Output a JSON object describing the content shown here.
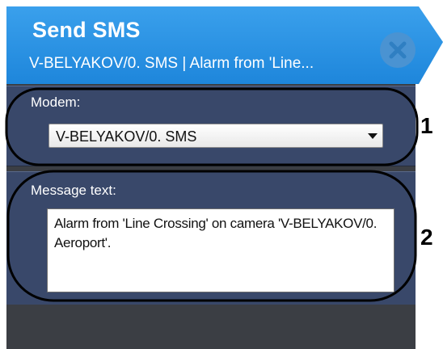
{
  "dialog": {
    "title": "Send SMS",
    "subtitle": "V-BELYAKOV/0. SMS | Alarm from 'Line...",
    "accent_color": "#2b8fe0",
    "close_icon": "close-icon"
  },
  "modem": {
    "label": "Modem:",
    "selected": "V-BELYAKOV/0. SMS"
  },
  "message": {
    "label": "Message text:",
    "value": "Alarm from 'Line Crossing' on camera 'V-BELYAKOV/0. Aeroport'."
  },
  "annotations": {
    "callout_1": "1",
    "callout_2": "2"
  }
}
